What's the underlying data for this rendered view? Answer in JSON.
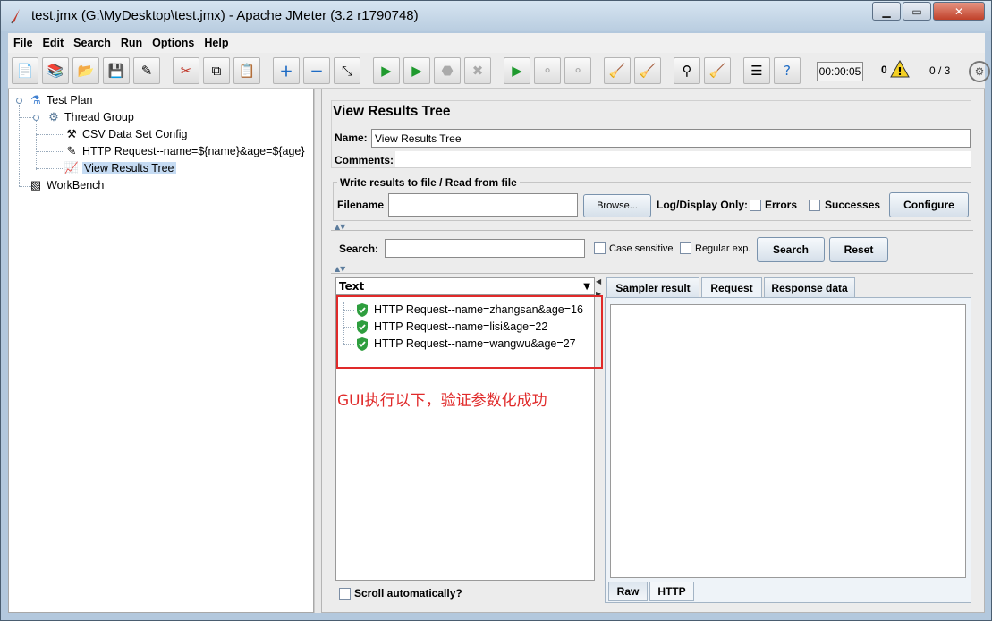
{
  "window": {
    "title": "test.jmx (G:\\MyDesktop\\test.jmx) - Apache JMeter (3.2 r1790748)"
  },
  "menu": [
    "File",
    "Edit",
    "Search",
    "Run",
    "Options",
    "Help"
  ],
  "status": {
    "elapsed": "00:00:05",
    "errors": "0",
    "threads": "0 / 3"
  },
  "tree": {
    "items": [
      {
        "label": "Test Plan"
      },
      {
        "label": "Thread Group"
      },
      {
        "label": "CSV Data Set Config"
      },
      {
        "label": "HTTP Request--name=${name}&age=${age}"
      },
      {
        "label": "View Results Tree"
      },
      {
        "label": "WorkBench"
      }
    ]
  },
  "panel": {
    "title": "View Results Tree",
    "name_label": "Name:",
    "name_value": "View Results Tree",
    "comments_label": "Comments:",
    "file_group_title": "Write results to file / Read from file",
    "filename_label": "Filename",
    "browse_label": "Browse...",
    "log_display_label": "Log/Display Only:",
    "errors_label": "Errors",
    "successes_label": "Successes",
    "configure_label": "Configure",
    "search_label": "Search:",
    "case_sensitive_label": "Case sensitive",
    "regex_label": "Regular exp.",
    "search_button": "Search",
    "reset_button": "Reset",
    "renderer_value": "Text",
    "results": [
      {
        "label": "HTTP Request--name=zhangsan&age=16"
      },
      {
        "label": "HTTP Request--name=lisi&age=22"
      },
      {
        "label": "HTTP Request--name=wangwu&age=27"
      }
    ],
    "annotation": "GUI执行以下，验证参数化成功",
    "scroll_label": "Scroll automatically?",
    "tabs": [
      "Sampler result",
      "Request",
      "Response data"
    ],
    "bottom_tabs": [
      "Raw",
      "HTTP"
    ]
  },
  "colors": {
    "accent_red": "#e02a2a",
    "selection": "#c5dbf3",
    "success_green": "#2e9e3e"
  }
}
